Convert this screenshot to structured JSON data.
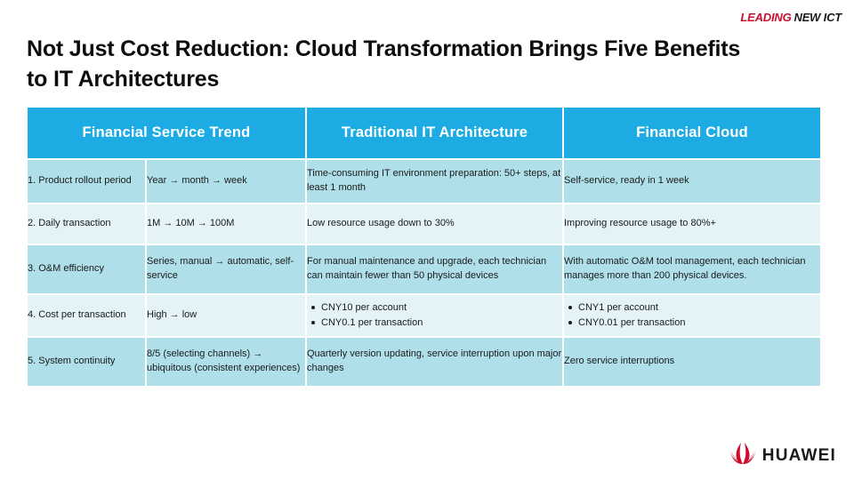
{
  "brand": {
    "leading": "LEADING",
    "new_ict": "NEW ICT",
    "leading_color": "#c8102e",
    "new_ict_color": "#1a1a1a"
  },
  "slide": {
    "title": "Not Just Cost Reduction: Cloud Transformation Brings Five Benefits to IT Architectures"
  },
  "table": {
    "header_bg": "#1CACE3",
    "row_dark_bg": "#AFE0E9",
    "row_light_bg": "#E3F3F8",
    "headers": [
      "Financial Service Trend",
      "Traditional IT Architecture",
      "Financial Cloud"
    ],
    "rows": [
      {
        "item": "1. Product rollout period",
        "trend": "Year → month → week",
        "traditional": "Time-consuming IT environment preparation: 50+ steps, at least 1 month",
        "cloud": "Self-service, ready in 1 week"
      },
      {
        "item": "2. Daily transaction",
        "trend": "1M → 10M → 100M",
        "traditional": "Low resource usage down to 30%",
        "cloud": "Improving resource usage to 80%+"
      },
      {
        "item": "3. O&M efficiency",
        "trend": "Series, manual → automatic, self-service",
        "traditional": "For manual maintenance and upgrade, each technician can maintain fewer than 50 physical devices",
        "cloud": "With automatic O&M tool management, each technician manages more than 200 physical devices."
      },
      {
        "item": "4. Cost per transaction",
        "trend": "High → low",
        "traditional_bullets": [
          "CNY10 per account",
          "CNY0.1 per transaction"
        ],
        "cloud_bullets": [
          "CNY1 per account",
          "CNY0.01 per transaction"
        ]
      },
      {
        "item": "5. System continuity",
        "trend": "8/5 (selecting channels) → ubiquitous (consistent experiences)",
        "traditional": "Quarterly version updating, service interruption upon major changes",
        "cloud": "Zero service interruptions"
      }
    ]
  },
  "footer_logo": {
    "wordmark": "HUAWEI",
    "mark_color": "#cf0a2c"
  }
}
